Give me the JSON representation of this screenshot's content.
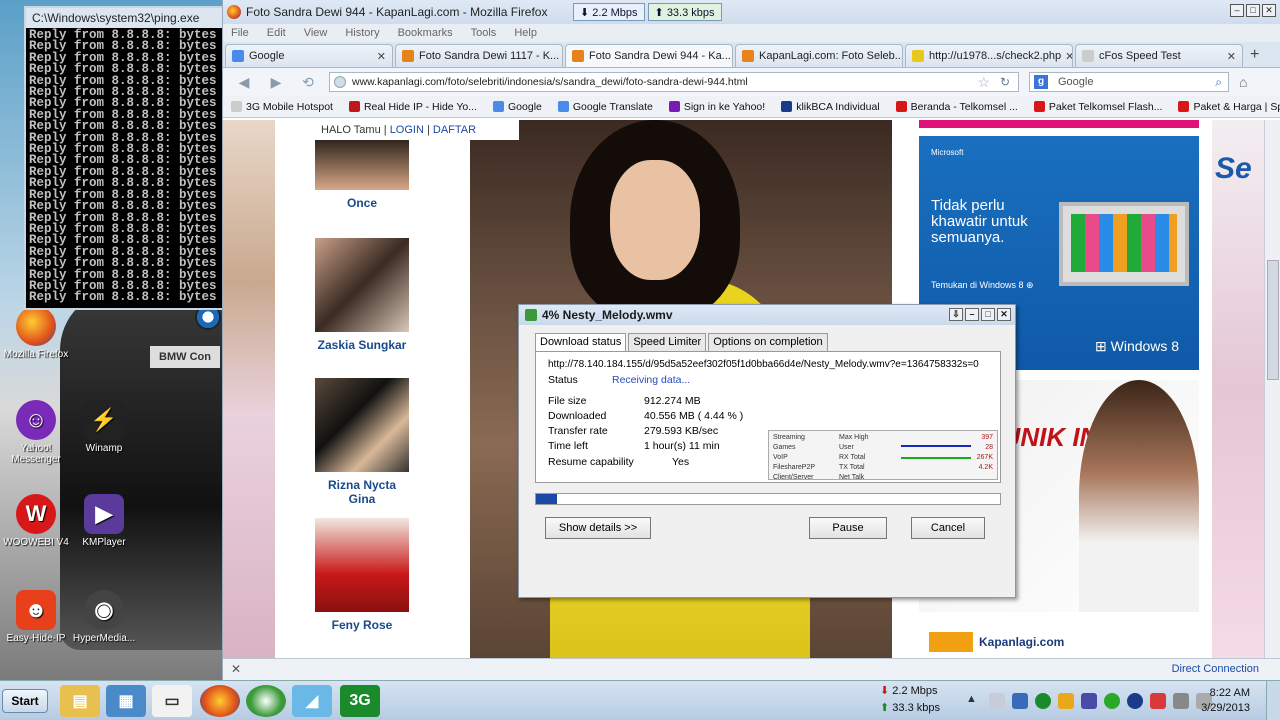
{
  "cmd": {
    "title": "C:\\Windows\\system32\\ping.exe",
    "lines": [
      "Reply from 8.8.8.8: bytes",
      "Reply from 8.8.8.8: bytes",
      "Reply from 8.8.8.8: bytes",
      "Reply from 8.8.8.8: bytes",
      "Reply from 8.8.8.8: bytes",
      "Reply from 8.8.8.8: bytes",
      "Reply from 8.8.8.8: bytes",
      "Reply from 8.8.8.8: bytes",
      "Reply from 8.8.8.8: bytes",
      "Reply from 8.8.8.8: bytes",
      "Reply from 8.8.8.8: bytes",
      "Reply from 8.8.8.8: bytes",
      "Reply from 8.8.8.8: bytes",
      "Reply from 8.8.8.8: bytes",
      "Reply from 8.8.8.8: bytes",
      "Reply from 8.8.8.8: bytes",
      "Reply from 8.8.8.8: bytes",
      "Reply from 8.8.8.8: bytes",
      "Reply from 8.8.8.8: bytes",
      "Reply from 8.8.8.8: bytes",
      "Reply from 8.8.8.8: bytes",
      "Reply from 8.8.8.8: bytes",
      "Reply from 8.8.8.8: bytes",
      "Reply from 8.8.8.8: bytes"
    ]
  },
  "desktop_icons": {
    "firefox": "Mozilla Firefox",
    "yahoo": "Yahoo! Messenger",
    "winamp": "Winamp",
    "woowebi": "WOOWEBI V4",
    "kmplayer": "KMPlayer",
    "easyhide": "Easy-Hide-IP",
    "hypermedia": "HyperMedia...",
    "car_plate": "BMW Con"
  },
  "firefox": {
    "title": "Foto Sandra Dewi 944 - KapanLagi.com - Mozilla Firefox",
    "speed_down": "2.2 Mbps",
    "speed_up": "33.3 kbps",
    "menu": [
      "File",
      "Edit",
      "View",
      "History",
      "Bookmarks",
      "Tools",
      "Help"
    ],
    "tabs": [
      {
        "label": "Google",
        "color": "#4a8ae8"
      },
      {
        "label": "Foto Sandra Dewi 1117 - K...",
        "color": "#e8821a"
      },
      {
        "label": "Foto Sandra Dewi 944 - Ka...",
        "color": "#e8821a"
      },
      {
        "label": "KapanLagi.com: Foto Seleb...",
        "color": "#e8821a"
      },
      {
        "label": "http://u1978...s/check2.php",
        "color": "#e8c81a"
      },
      {
        "label": "cFos Speed Test",
        "color": "#cccccc"
      }
    ],
    "url": "www.kapanlagi.com/foto/selebriti/indonesia/s/sandra_dewi/foto-sandra-dewi-944.html",
    "search_placeholder": "Google",
    "bookmarks": [
      {
        "label": "3G Mobile Hotspot",
        "color": "#cccccc"
      },
      {
        "label": "Real Hide IP - Hide Yo...",
        "color": "#c01818"
      },
      {
        "label": "Google",
        "color": "#4a8ae8"
      },
      {
        "label": "Google Translate",
        "color": "#4a8ae8"
      },
      {
        "label": "Sign in ke Yahoo!",
        "color": "#7a1ab8"
      },
      {
        "label": "klikBCA Individual",
        "color": "#1a3a8a"
      },
      {
        "label": "Beranda - Telkomsel ...",
        "color": "#d81818"
      },
      {
        "label": "Paket Telkomsel Flash...",
        "color": "#d81818"
      },
      {
        "label": "Paket & Harga | Spee...",
        "color": "#d81818"
      }
    ],
    "status_right": "Direct Connection"
  },
  "page": {
    "halo": "HALO Tamu |",
    "login": "LOGIN",
    "sep": "|",
    "daftar": "DAFTAR",
    "celebs": [
      "Once",
      "Zaskia Sungkar",
      "Rizna Nycta Gina",
      "Feny Rose"
    ],
    "ad_ms": "Microsoft",
    "ad_headline": "Tidak perlu khawatir untuk semuanya.",
    "ad_cta": "Temukan di Windows 8 ⊕",
    "ad_w8": "Windows 8",
    "ad2_text": "AKTA UNIK IN",
    "kapanlagi": "Kapanlagi.com",
    "right_text": "Se"
  },
  "download": {
    "title": "4% Nesty_Melody.wmv",
    "tabs": [
      "Download status",
      "Speed Limiter",
      "Options on completion"
    ],
    "url": "http://78.140.184.155/d/95d5a52eef302f05f1d0bba66d4e/Nesty_Melody.wmv?e=1364758332s=0",
    "status_label": "Status",
    "status_value": "Receiving data...",
    "file_size_label": "File size",
    "file_size": "912.274  MB",
    "downloaded_label": "Downloaded",
    "downloaded": "40.556  MB  ( 4.44 % )",
    "rate_label": "Transfer rate",
    "rate": "279.593  KB/sec",
    "time_label": "Time left",
    "time_left": "1 hour(s) 11 min",
    "resume_label": "Resume capability",
    "resume": "Yes",
    "graph_legend_a": [
      "Streaming",
      "Games",
      "VoIP",
      "FileshareP2P",
      "Client/Server"
    ],
    "graph_legend_b": [
      "Max High",
      "User",
      "RX Total",
      "TX Total",
      "Net Talk"
    ],
    "graph_nums": [
      "397",
      "28",
      "267K",
      "4.2K"
    ],
    "progress": 0.0444,
    "btn_details": "Show details >>",
    "btn_pause": "Pause",
    "btn_cancel": "Cancel"
  },
  "taskbar": {
    "start": "Start",
    "speed_down": "2.2 Mbps",
    "speed_up": "33.3 kbps",
    "time": "8:22 AM",
    "date": "3/29/2013"
  }
}
